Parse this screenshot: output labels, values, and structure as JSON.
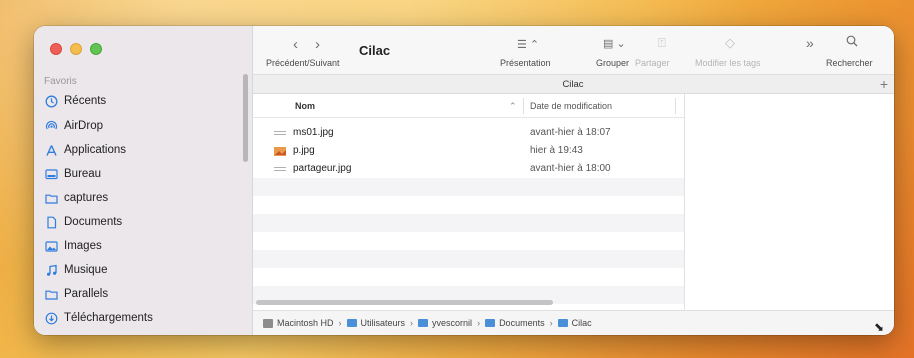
{
  "window": {
    "title": "Cilac",
    "tab_title": "Cilac"
  },
  "sidebar": {
    "heading": "Favoris",
    "items": [
      {
        "label": "Récents",
        "icon": "clock-icon"
      },
      {
        "label": "AirDrop",
        "icon": "airdrop-icon"
      },
      {
        "label": "Applications",
        "icon": "applications-icon"
      },
      {
        "label": "Bureau",
        "icon": "desktop-icon"
      },
      {
        "label": "captures",
        "icon": "folder-icon"
      },
      {
        "label": "Documents",
        "icon": "document-icon"
      },
      {
        "label": "Images",
        "icon": "photo-icon"
      },
      {
        "label": "Musique",
        "icon": "music-icon"
      },
      {
        "label": "Parallels",
        "icon": "folder-icon"
      },
      {
        "label": "Téléchargements",
        "icon": "download-icon"
      }
    ]
  },
  "toolbar": {
    "nav_label": "Précédent/Suivant",
    "presentation_label": "Présentation",
    "group_label": "Grouper",
    "share_label": "Partager",
    "tags_label": "Modifier les tags",
    "search_label": "Rechercher"
  },
  "list": {
    "col_name": "Nom",
    "col_date": "Date de modification",
    "files": [
      {
        "name": "ms01.jpg",
        "date": "avant-hier à 18:07",
        "icon": "document-thumb-icon"
      },
      {
        "name": "p.jpg",
        "date": "hier à 19:43",
        "icon": "image-thumb-icon"
      },
      {
        "name": "partageur.jpg",
        "date": "avant-hier à 18:00",
        "icon": "document-thumb-icon"
      }
    ]
  },
  "path": [
    "Macintosh HD",
    "Utilisateurs",
    "yvescornil",
    "Documents",
    "Cilac"
  ],
  "colors": {
    "accent": "#2f7de1",
    "sidebar_bg": "#ebe7ea",
    "close": "#ee5f57",
    "minimize": "#f5bd4f",
    "zoom": "#61c453"
  }
}
